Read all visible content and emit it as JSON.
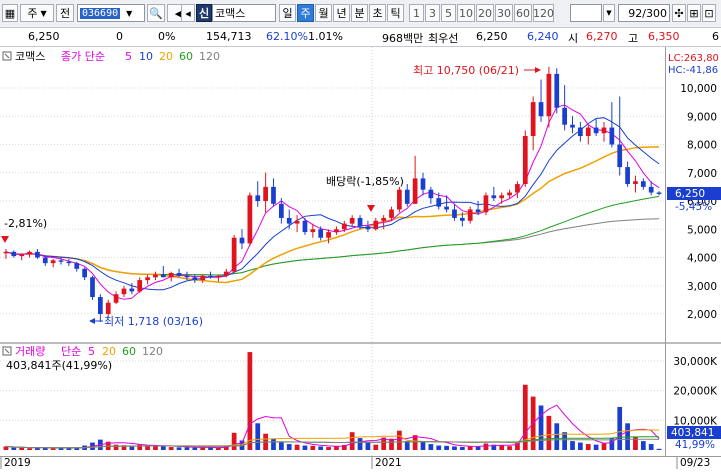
{
  "toolbar": {
    "market_label": "주",
    "period_label": "전",
    "code_value": "036690",
    "dropdown_glyph": "▼",
    "search_glyph": "🔍",
    "sound_glyph": "◀",
    "prev_glyph": "◂",
    "new_badge": "신",
    "stock_name": "코맥스",
    "timeframes": [
      "일",
      "주",
      "월",
      "년",
      "분",
      "초",
      "틱"
    ],
    "timeframe_selected": "주",
    "intervals": [
      "1",
      "3",
      "5",
      "10",
      "20",
      "30",
      "60",
      "120"
    ],
    "count_value": "92",
    "count_total": "/300",
    "tool_glyphs": [
      "✣",
      "⊞",
      "⊡",
      "▣",
      "≡"
    ]
  },
  "infobar": {
    "price": "6,250",
    "change": "0",
    "change_pct": "0%",
    "volume": "154,713",
    "vol_ratio": "62.10%",
    "turnover_ratio": "1.01%",
    "amount": "968백만",
    "best_bid_label": "최우선",
    "best_bid": "6,250",
    "best_ask": "6,240",
    "open_label": "시",
    "open": "6,270",
    "high_label": "고",
    "high": "6,350",
    "low_partial": "6"
  },
  "price_panel": {
    "legend_name": "코맥스",
    "legend_close_icon": "close-icon",
    "ma_label": "종가 단순",
    "ma_periods": [
      "5",
      "10",
      "20",
      "60",
      "120"
    ],
    "ma_colors": [
      "#e000e0",
      "#1a3fd0",
      "#f0a000",
      "#20a020",
      "#808080"
    ],
    "left_pct": "-2,81%)",
    "lc_label": "LC:263,80",
    "hc_label": "HC:-41,86",
    "high_annotation": "최고 10,750 (06/21)",
    "low_annotation": "최저 1,718 (03/16)",
    "dividend_annotation": "배당락(-1,85%)",
    "current_price": "6,250",
    "current_pct": "-5,45%",
    "y_ticks": [
      "10,000",
      "9,000",
      "8,000",
      "7,000",
      "6,000",
      "5,000",
      "4,000",
      "3,000",
      "2,000"
    ]
  },
  "volume_panel": {
    "legend_name": "거래량",
    "ma_label": "단순",
    "ma_periods": [
      "5",
      "20",
      "60",
      "120"
    ],
    "ma_colors": [
      "#e000e0",
      "#f0a000",
      "#20a020",
      "#808080"
    ],
    "last_volume": "403,841주(41,99%)",
    "current_volume": "403,841",
    "current_pct": "41,99%",
    "y_ticks": [
      "30,000K",
      "20,000K",
      "10,000K"
    ]
  },
  "x_axis": {
    "labels": [
      "2019",
      "2021",
      "09/23"
    ]
  },
  "chart_data": {
    "type": "candlestick",
    "x": [
      "2019",
      "2021",
      "09/23"
    ],
    "price_ylim": [
      1300,
      10750
    ],
    "price_high": 10750,
    "price_high_date": "06/21",
    "price_low": 1718,
    "price_low_date": "03/16",
    "ohlc": [
      [
        4150,
        4300,
        3950,
        4200
      ],
      [
        4200,
        4250,
        4000,
        4050
      ],
      [
        4050,
        4150,
        3900,
        4100
      ],
      [
        4100,
        4250,
        4000,
        4200
      ],
      [
        4200,
        4300,
        3950,
        4000
      ],
      [
        4000,
        4050,
        3700,
        3800
      ],
      [
        3800,
        3950,
        3650,
        3900
      ],
      [
        3900,
        4000,
        3750,
        3850
      ],
      [
        3850,
        3950,
        3700,
        3800
      ],
      [
        3800,
        3850,
        3500,
        3600
      ],
      [
        3600,
        3650,
        3200,
        3300
      ],
      [
        3300,
        3350,
        2500,
        2600
      ],
      [
        2600,
        2700,
        1718,
        2000
      ],
      [
        2000,
        2500,
        1900,
        2400
      ],
      [
        2400,
        2800,
        2350,
        2700
      ],
      [
        2700,
        3000,
        2600,
        2900
      ],
      [
        2900,
        3100,
        2700,
        2800
      ],
      [
        2800,
        3300,
        2750,
        3200
      ],
      [
        3200,
        3400,
        3050,
        3300
      ],
      [
        3300,
        3500,
        3200,
        3400
      ],
      [
        3400,
        3700,
        3300,
        3300
      ],
      [
        3300,
        3500,
        3150,
        3450
      ],
      [
        3450,
        3600,
        3300,
        3350
      ],
      [
        3350,
        3500,
        3200,
        3300
      ],
      [
        3300,
        3400,
        3100,
        3200
      ],
      [
        3200,
        3400,
        3100,
        3350
      ],
      [
        3350,
        3500,
        3250,
        3300
      ],
      [
        3300,
        3400,
        3150,
        3350
      ],
      [
        3350,
        3600,
        3300,
        3500
      ],
      [
        3500,
        4800,
        3450,
        4700
      ],
      [
        4700,
        5000,
        4300,
        4500
      ],
      [
        4500,
        6300,
        4400,
        6200
      ],
      [
        6200,
        6700,
        5800,
        6000
      ],
      [
        6000,
        7000,
        5600,
        6500
      ],
      [
        6500,
        6800,
        5800,
        5900
      ],
      [
        5900,
        6100,
        5200,
        5400
      ],
      [
        5400,
        5700,
        5000,
        5200
      ],
      [
        5200,
        5500,
        4900,
        5300
      ],
      [
        5300,
        5400,
        4800,
        4900
      ],
      [
        4900,
        5200,
        4700,
        5000
      ],
      [
        5000,
        5100,
        4600,
        4700
      ],
      [
        4700,
        5000,
        4500,
        4900
      ],
      [
        4900,
        5100,
        4800,
        5000
      ],
      [
        5000,
        5300,
        4900,
        5200
      ],
      [
        5200,
        5500,
        5100,
        5400
      ],
      [
        5400,
        5500,
        5000,
        5100
      ],
      [
        5100,
        5300,
        4900,
        5000
      ],
      [
        5000,
        5400,
        4950,
        5300
      ],
      [
        5300,
        5500,
        5000,
        5400
      ],
      [
        5400,
        5800,
        5300,
        5700
      ],
      [
        5700,
        6500,
        5600,
        6400
      ],
      [
        6400,
        6600,
        5800,
        5900
      ],
      [
        5900,
        7600,
        5900,
        6800
      ],
      [
        6800,
        7000,
        6200,
        6400
      ],
      [
        6400,
        6500,
        5900,
        6100
      ],
      [
        6100,
        6300,
        5700,
        5800
      ],
      [
        5800,
        6200,
        5600,
        5700
      ],
      [
        5700,
        5900,
        5300,
        5400
      ],
      [
        5400,
        5600,
        5100,
        5300
      ],
      [
        5300,
        5800,
        5200,
        5700
      ],
      [
        5700,
        6000,
        5500,
        5600
      ],
      [
        5600,
        6300,
        5500,
        6200
      ],
      [
        6200,
        6500,
        6000,
        6100
      ],
      [
        6100,
        6300,
        5900,
        6200
      ],
      [
        6200,
        6400,
        6100,
        6300
      ],
      [
        6300,
        6700,
        6100,
        6600
      ],
      [
        6600,
        8500,
        6500,
        8300
      ],
      [
        8300,
        9700,
        7800,
        9500
      ],
      [
        9500,
        10300,
        8800,
        9000
      ],
      [
        9000,
        10750,
        8600,
        10500
      ],
      [
        10500,
        10700,
        9100,
        9300
      ],
      [
        9300,
        10100,
        8500,
        8700
      ],
      [
        8700,
        9000,
        8400,
        8600
      ],
      [
        8600,
        8800,
        8100,
        8300
      ],
      [
        8300,
        8700,
        8000,
        8600
      ],
      [
        8600,
        8900,
        8300,
        8400
      ],
      [
        8400,
        8800,
        8100,
        8600
      ],
      [
        8600,
        9500,
        7900,
        8000
      ],
      [
        8000,
        9700,
        6900,
        7200
      ],
      [
        7200,
        7400,
        6500,
        6600
      ],
      [
        6600,
        6900,
        6300,
        6700
      ],
      [
        6700,
        6800,
        6400,
        6500
      ],
      [
        6500,
        6700,
        6200,
        6300
      ],
      [
        6300,
        6350,
        6200,
        6250
      ]
    ],
    "volume_ylim": [
      0,
      35000
    ],
    "volume": [
      1200,
      800,
      700,
      600,
      900,
      700,
      500,
      600,
      700,
      800,
      1500,
      2500,
      3500,
      2800,
      1800,
      1600,
      1400,
      1800,
      1600,
      1300,
      1200,
      1000,
      900,
      900,
      800,
      800,
      900,
      700,
      1200,
      5800,
      3200,
      33000,
      9000,
      5500,
      3800,
      2800,
      2000,
      1800,
      1500,
      1400,
      1200,
      1000,
      1300,
      1700,
      6000,
      4000,
      2500,
      1800,
      4200,
      3800,
      6500,
      3000,
      5000,
      2800,
      2000,
      1500,
      1400,
      1200,
      1000,
      1300,
      1100,
      2200,
      1800,
      1500,
      1300,
      2500,
      22000,
      18000,
      15000,
      11500,
      9000,
      6000,
      3000,
      2500,
      2000,
      1800,
      2200,
      4000,
      14500,
      9000,
      4500,
      3000,
      2000,
      403.8
    ]
  }
}
